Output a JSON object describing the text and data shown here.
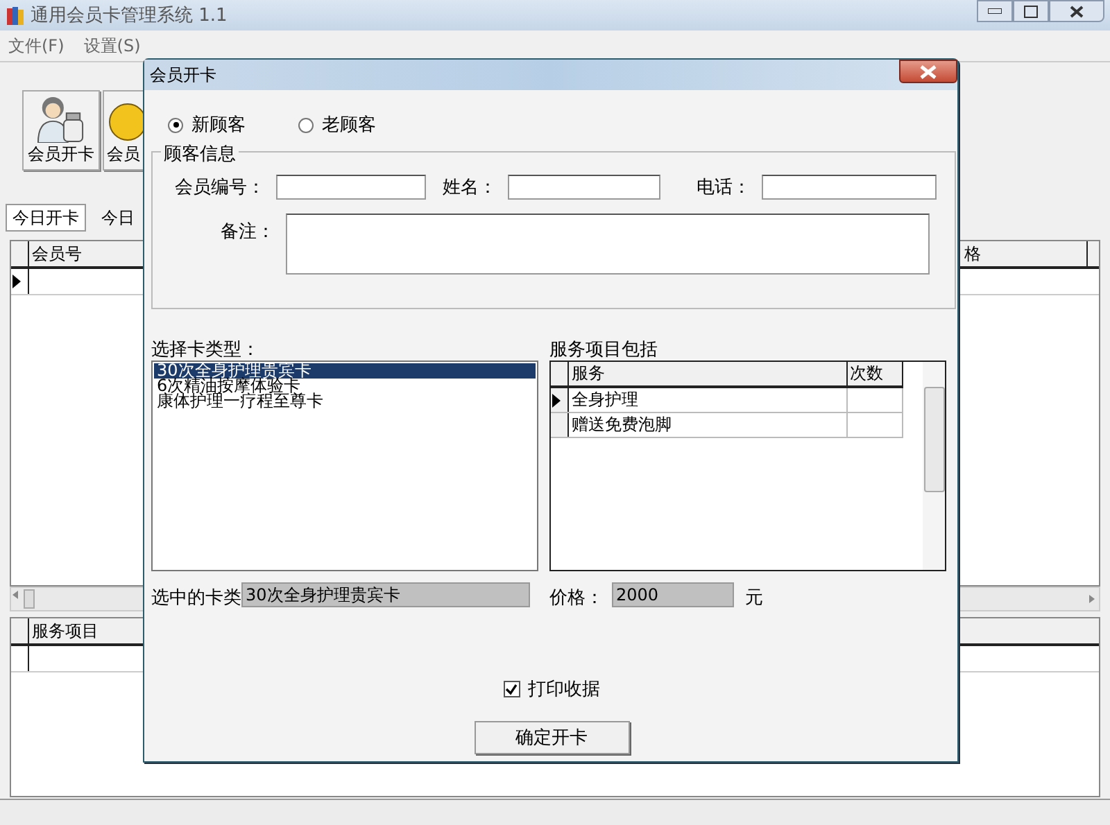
{
  "window": {
    "title": "通用会员卡管理系统 1.1"
  },
  "menu": [
    {
      "label": "文件(F)"
    },
    {
      "label": "设置(S)"
    }
  ],
  "toolbar": [
    {
      "label": "会员开卡",
      "kind": "person"
    },
    {
      "label": "会员",
      "kind": "smiley"
    }
  ],
  "tabs": [
    {
      "label": "今日开卡",
      "selected": true
    },
    {
      "label": "今日",
      "selected": false
    }
  ],
  "top_grid": {
    "columns": [
      "会员号",
      "格"
    ]
  },
  "bottom_grid": {
    "columns": [
      "服务项目"
    ]
  },
  "dialog": {
    "title": "会员开卡",
    "customer_type": [
      {
        "label": "新顾客",
        "selected": true
      },
      {
        "label": "老顾客",
        "selected": false
      }
    ],
    "group_title": "顾客信息",
    "fields": [
      {
        "label": "会员编号：",
        "kind": "input"
      },
      {
        "label": "姓名：",
        "kind": "input"
      },
      {
        "label": "电话：",
        "kind": "input"
      },
      {
        "label": "备注：",
        "kind": "textarea"
      }
    ],
    "card_types": {
      "label": "选择卡类型：",
      "items": [
        {
          "label": "30次全身护理贵宾卡",
          "selected": true
        },
        {
          "label": "6次精油按摩体验卡",
          "selected": false
        },
        {
          "label": "康体护理一疗程至尊卡",
          "selected": false
        }
      ]
    },
    "services": {
      "label": "服务项目包括",
      "columns": [
        "服务",
        "次数"
      ],
      "rows": [
        {
          "service": "全身护理",
          "current": true
        },
        {
          "service": "赠送免费泡脚",
          "current": false
        }
      ]
    },
    "selected_card": {
      "label": "选中的卡类",
      "value": "30次全身护理贵宾卡"
    },
    "price": {
      "label": "价格：",
      "value": "2000",
      "unit": "元"
    },
    "print_receipt": {
      "label": "打印收据",
      "checked": true
    },
    "confirm_button": "确定开卡"
  }
}
